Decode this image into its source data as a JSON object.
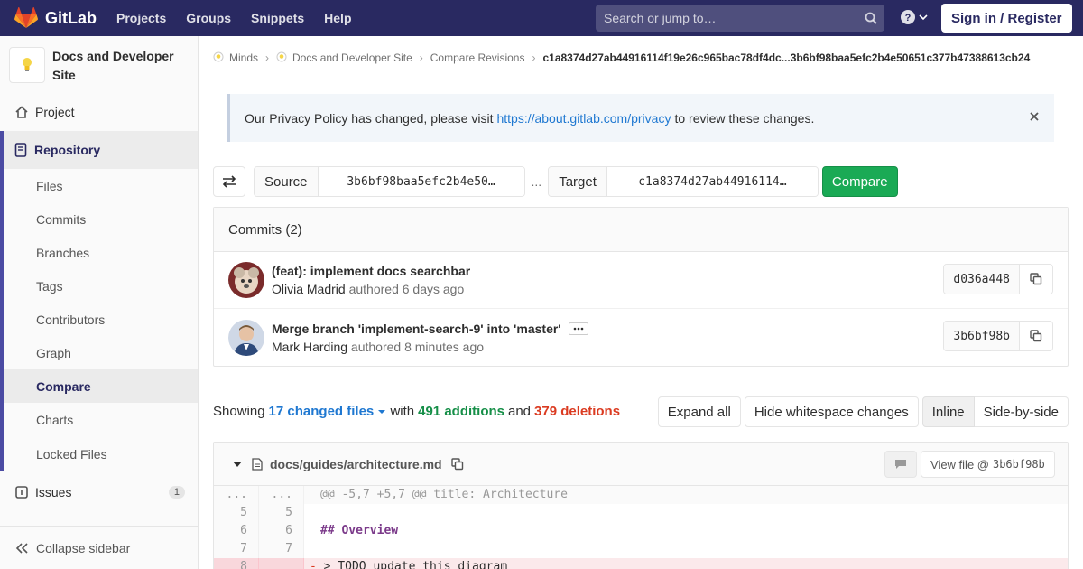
{
  "navbar": {
    "brand": "GitLab",
    "links": [
      "Projects",
      "Groups",
      "Snippets",
      "Help"
    ],
    "search_placeholder": "Search or jump to…",
    "signin_label": "Sign in / Register"
  },
  "sidebar": {
    "project_name": "Docs and Developer Site",
    "project_label": "Project",
    "repository_label": "Repository",
    "repo_items": [
      "Files",
      "Commits",
      "Branches",
      "Tags",
      "Contributors",
      "Graph",
      "Compare",
      "Charts",
      "Locked Files"
    ],
    "active_item": "Compare",
    "issues_label": "Issues",
    "issues_count": "1",
    "collapse_label": "Collapse sidebar"
  },
  "breadcrumb": {
    "items": [
      "Minds",
      "Docs and Developer Site",
      "Compare Revisions"
    ],
    "current": "c1a8374d27ab44916114f19e26c965bac78df4dc...3b6bf98baa5efc2b4e50651c377b47388613cb24"
  },
  "alert": {
    "prefix": "Our Privacy Policy has changed, please visit",
    "link": "https://about.gitlab.com/privacy",
    "suffix": "to review these changes."
  },
  "compare": {
    "source_label": "Source",
    "source_value": "3b6bf98baa5efc2b4e50…",
    "ellipsis": "...",
    "target_label": "Target",
    "target_value": "c1a8374d27ab44916114…",
    "compare_label": "Compare"
  },
  "commits": {
    "header": "Commits (2)",
    "items": [
      {
        "title": "(feat): implement docs searchbar",
        "author": "Olivia Madrid",
        "authored": "authored 6 days ago",
        "sha": "d036a448"
      },
      {
        "title": "Merge branch 'implement-search-9' into 'master'",
        "author": "Mark Harding",
        "authored": "authored 8 minutes ago",
        "sha": "3b6bf98b"
      }
    ]
  },
  "diff_summary": {
    "showing": "Showing",
    "files": "17 changed files",
    "with": "with",
    "additions": "491 additions",
    "and": "and",
    "deletions": "379 deletions"
  },
  "diff_actions": {
    "expand_all": "Expand all",
    "hide_whitespace": "Hide whitespace changes",
    "inline": "Inline",
    "side_by_side": "Side-by-side"
  },
  "file": {
    "path": "docs/guides/architecture.md",
    "view_label": "View file @",
    "view_sha": "3b6bf98b",
    "lines": [
      {
        "type": "match",
        "old": "...",
        "new": "...",
        "code": "@@ -5,7 +5,7 @@ title: Architecture"
      },
      {
        "type": "context",
        "old": "5",
        "new": "5",
        "code": ""
      },
      {
        "type": "context",
        "old": "6",
        "new": "6",
        "code": "## Overview"
      },
      {
        "type": "context",
        "old": "7",
        "new": "7",
        "code": ""
      },
      {
        "type": "del",
        "old": "8",
        "new": "",
        "code": "> TODO update this diagram"
      }
    ]
  },
  "colors": {
    "navbar": "#292961",
    "accent": "#4b4ba3",
    "link": "#1f78d1",
    "additions": "#168f48",
    "deletions": "#db3b21",
    "compare_button": "#1aaa55"
  }
}
